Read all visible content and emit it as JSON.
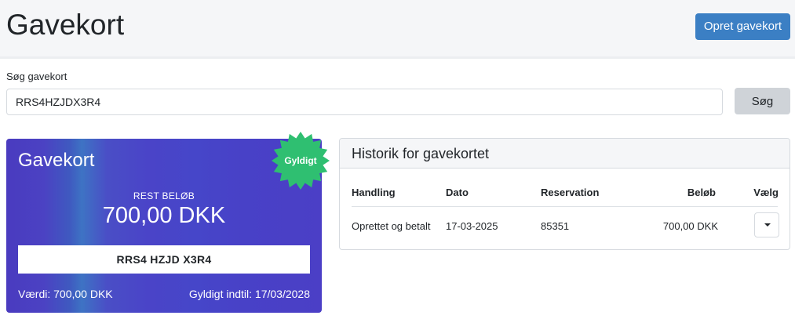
{
  "header": {
    "title": "Gavekort",
    "create_button": "Opret gavekort"
  },
  "search": {
    "label": "Søg gavekort",
    "value": "RRS4HZJDX3R4",
    "button": "Søg"
  },
  "giftcard": {
    "title": "Gavekort",
    "status_badge": "Gyldigt",
    "rest_label": "REST BELØB",
    "rest_amount": "700,00 DKK",
    "code": "RRS4 HZJD X3R4",
    "value_text": "Værdi: 700,00 DKK",
    "valid_until": "Gyldigt indtil: 17/03/2028",
    "badge_color": "#2fbf71"
  },
  "history": {
    "title": "Historik for gavekortet",
    "columns": [
      "Handling",
      "Dato",
      "Reservation",
      "Beløb",
      "Vælg"
    ],
    "rows": [
      {
        "action": "Oprettet og betalt",
        "date": "17-03-2025",
        "reservation": "85351",
        "amount": "700,00 DKK",
        "select_icon": "caret-down-icon"
      }
    ]
  },
  "colors": {
    "primary": "#3b7fc4",
    "secondary": "#cfd3d8",
    "card_gradient_start": "#4a3bbf",
    "card_gradient_end": "#4b3fc6"
  }
}
